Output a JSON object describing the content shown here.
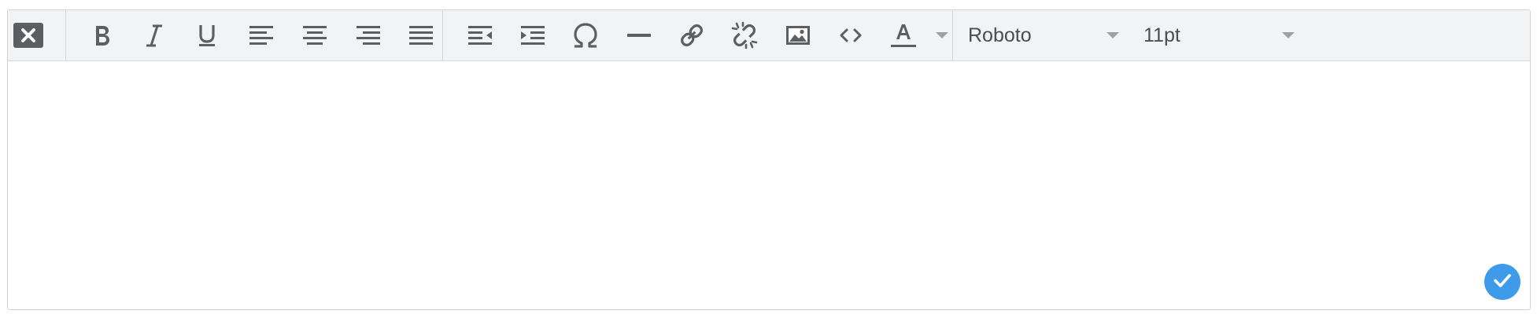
{
  "toolbar": {
    "buttons": [
      {
        "name": "clear-format-button",
        "icon": "close-x-icon"
      },
      {
        "name": "bold-button",
        "icon": "bold-icon"
      },
      {
        "name": "italic-button",
        "icon": "italic-icon"
      },
      {
        "name": "underline-button",
        "icon": "underline-icon"
      },
      {
        "name": "align-left-button",
        "icon": "align-left-icon"
      },
      {
        "name": "align-center-button",
        "icon": "align-center-icon"
      },
      {
        "name": "align-right-button",
        "icon": "align-right-icon"
      },
      {
        "name": "align-justify-button",
        "icon": "align-justify-icon"
      },
      {
        "name": "outdent-button",
        "icon": "outdent-icon"
      },
      {
        "name": "indent-button",
        "icon": "indent-icon"
      },
      {
        "name": "special-character-button",
        "icon": "omega-icon"
      },
      {
        "name": "horizontal-rule-button",
        "icon": "horizontal-line-icon"
      },
      {
        "name": "insert-link-button",
        "icon": "link-icon"
      },
      {
        "name": "remove-link-button",
        "icon": "unlink-icon"
      },
      {
        "name": "insert-image-button",
        "icon": "image-icon"
      },
      {
        "name": "source-code-button",
        "icon": "code-icon"
      },
      {
        "name": "text-color-button",
        "icon": "text-color-icon"
      }
    ],
    "font_family": {
      "value": "Roboto"
    },
    "font_size": {
      "value": "11pt"
    }
  },
  "editor": {
    "content": ""
  },
  "confirm": {
    "icon": "checkmark-icon"
  },
  "colors": {
    "toolbar_bg": "#f2f3f5",
    "icon": "#5b5e63",
    "accent": "#3d9be9",
    "border": "#cfd3d8"
  }
}
